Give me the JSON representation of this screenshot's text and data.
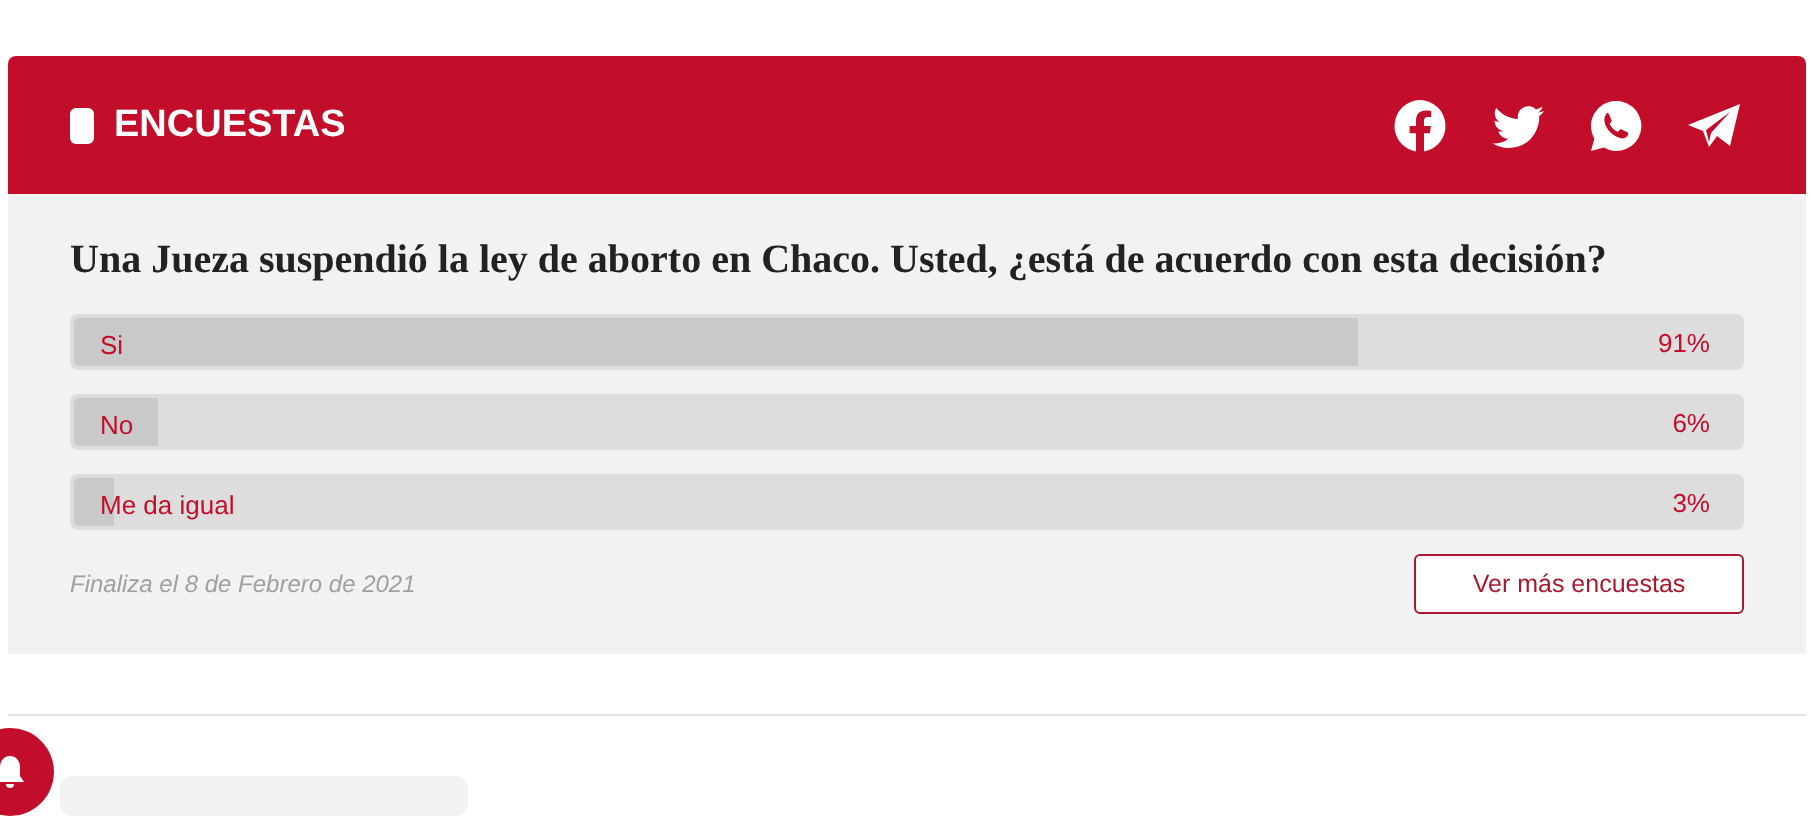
{
  "header": {
    "title": "ENCUESTAS"
  },
  "poll": {
    "question": "Una Jueza suspendió la ley de aborto en Chaco. Usted, ¿está de acuerdo con esta decisión?",
    "options": [
      {
        "label": "Si",
        "level": 0.77,
        "reading": "91%"
      },
      {
        "label": "No",
        "level": 0.052,
        "reading": "6%"
      },
      {
        "label": "Me da igual",
        "level": 0.026,
        "reading": "3%"
      }
    ],
    "end_note": "Finaliza el 8 de Febrero de 2021",
    "more_button": "Ver más encuestas"
  }
}
